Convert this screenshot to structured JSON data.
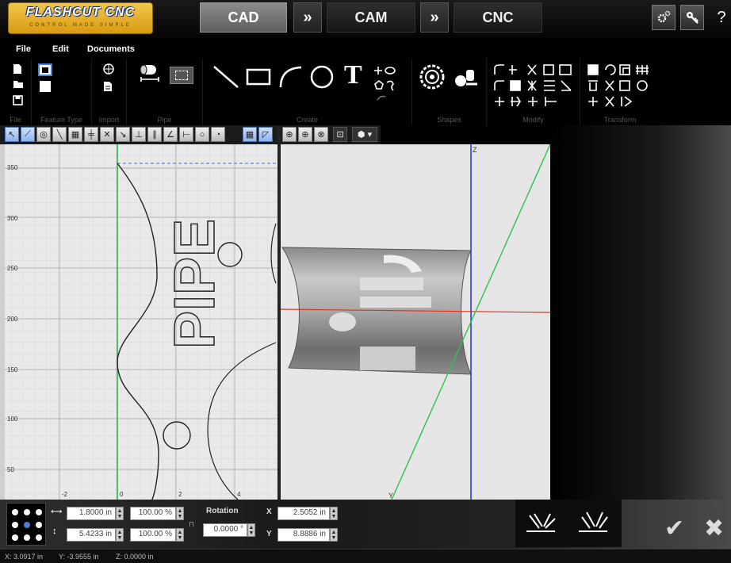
{
  "app": {
    "logo_title": "FLASHCUT CNC",
    "logo_tagline": "CONTROL MADE SIMPLE"
  },
  "mode_tabs": [
    {
      "label": "CAD",
      "active": true
    },
    {
      "label": "CAM",
      "active": false
    },
    {
      "label": "CNC",
      "active": false
    }
  ],
  "arrows": {
    "glyph": "»"
  },
  "top_right_icons": [
    "gear-icon",
    "key-icon",
    "help-icon"
  ],
  "help_glyph": "?",
  "menu": {
    "file": "File",
    "edit": "Edit",
    "documents": "Documents"
  },
  "ribbon_groups": [
    {
      "label": "File"
    },
    {
      "label": "Feature Type"
    },
    {
      "label": "Import"
    },
    {
      "label": "Pipe"
    },
    {
      "label": "Create"
    },
    {
      "label": "Shapes"
    },
    {
      "label": "Modify"
    },
    {
      "label": "Transform"
    }
  ],
  "create": {
    "text_tool": "T"
  },
  "cad_view": {
    "y_ticks": [
      "350",
      "300",
      "250",
      "200",
      "150",
      "100",
      "50"
    ],
    "x_ticks": [
      "-2",
      "0",
      "2",
      "4"
    ],
    "text_shape": "PIPE"
  },
  "view3d": {
    "axis_label_top": "Z",
    "axis_label_bottom": "Y"
  },
  "bottom": {
    "width": "1.8000 in",
    "width_pct": "100.00 %",
    "height": "5.4233 in",
    "height_pct": "100.00 %",
    "rotation_label": "Rotation",
    "rotation": "0.0000 °",
    "x_label": "X",
    "x_value": "2.5052 in",
    "y_label": "Y",
    "y_value": "8.8886 in"
  },
  "status": {
    "x": "X: 3.0917 in",
    "y": "Y: -3.9555 in",
    "z": "Z: 0.0000 in"
  },
  "confirm": {
    "ok": "✔",
    "cancel": "✖"
  }
}
